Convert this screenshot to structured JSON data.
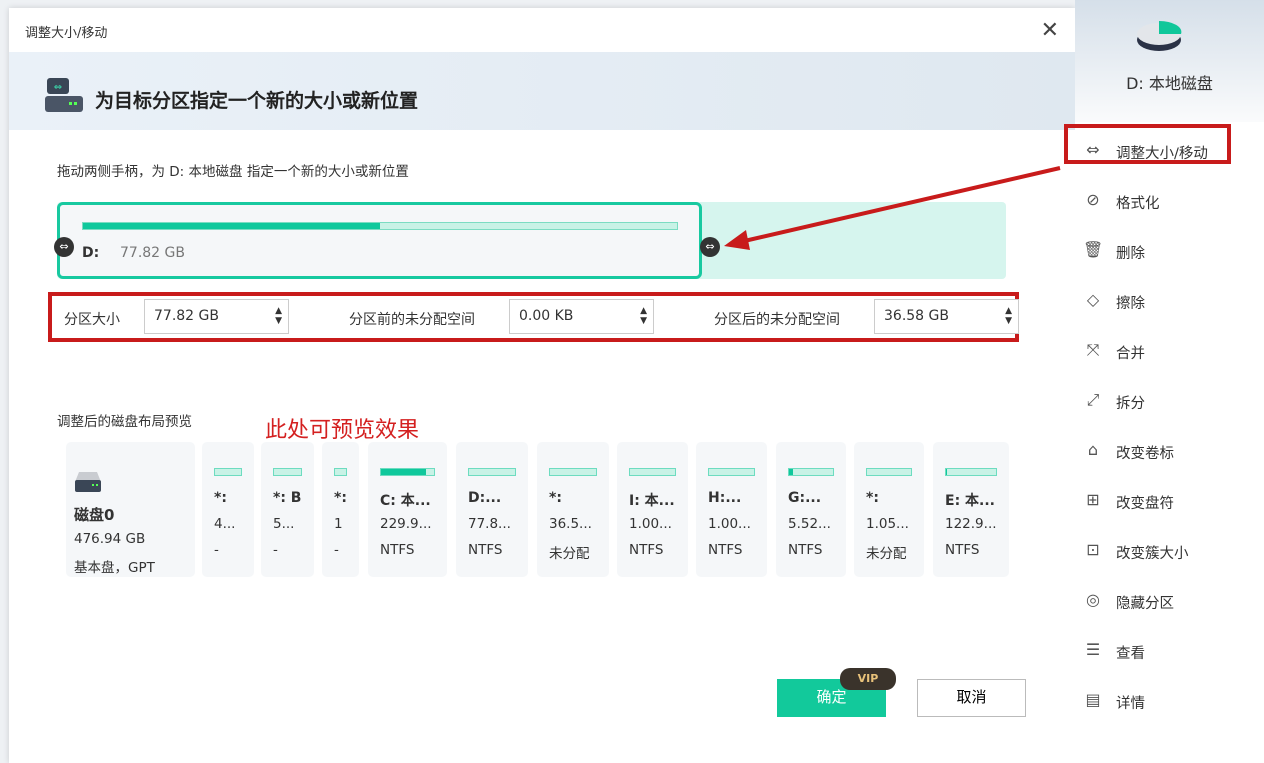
{
  "dialog": {
    "title": "调整大小/移动",
    "header": "为目标分区指定一个新的大小或新位置",
    "instruction": "拖动两侧手柄，为 D: 本地磁盘 指定一个新的大小或新位置"
  },
  "partition": {
    "name": "D:",
    "size": "77.82  GB",
    "used_fraction": 0.5
  },
  "fields": {
    "size_label": "分区大小",
    "size_value": "77.82  GB",
    "before_label": "分区前的未分配空间",
    "before_value": "0.00 KB",
    "after_label": "分区后的未分配空间",
    "after_value": "36.58  GB"
  },
  "preview": {
    "label": "调整后的磁盘布局预览",
    "annotation": "此处可预览效果",
    "disk": {
      "name": "磁盘0",
      "size": "476.94  GB",
      "type": "基本盘，GPT"
    },
    "cards": [
      {
        "name": "*:",
        "size": "4...",
        "fs": "-",
        "fill": 0
      },
      {
        "name": "*: B",
        "size": "5...",
        "fs": "-",
        "fill": 0
      },
      {
        "name": "*:",
        "size": "1",
        "fs": "-",
        "fill": 0
      },
      {
        "name": "C: 本...",
        "size": "229.9...",
        "fs": "NTFS",
        "fill": 0.85
      },
      {
        "name": "D:...",
        "size": "77.8...",
        "fs": "NTFS",
        "fill": 0
      },
      {
        "name": "*:",
        "size": "36.5...",
        "fs": "未分配",
        "fill": 0
      },
      {
        "name": "I: 本...",
        "size": "1.00...",
        "fs": "NTFS",
        "fill": 0
      },
      {
        "name": "H:...",
        "size": "1.00...",
        "fs": "NTFS",
        "fill": 0
      },
      {
        "name": "G:...",
        "size": "5.52...",
        "fs": "NTFS",
        "fill": 0.1
      },
      {
        "name": "*:",
        "size": "1.05...",
        "fs": "未分配",
        "fill": 0
      },
      {
        "name": "E: 本...",
        "size": "122.9...",
        "fs": "NTFS",
        "fill": 0.02
      }
    ]
  },
  "buttons": {
    "ok": "确定",
    "vip": "VIP",
    "cancel": "取消"
  },
  "sidebar": {
    "title": "D: 本地磁盘",
    "items": [
      {
        "label": "调整大小/移动",
        "icon": "resize-icon"
      },
      {
        "label": "格式化",
        "icon": "format-icon"
      },
      {
        "label": "删除",
        "icon": "delete-icon"
      },
      {
        "label": "擦除",
        "icon": "eraser-icon"
      },
      {
        "label": "合并",
        "icon": "merge-icon"
      },
      {
        "label": "拆分",
        "icon": "split-icon"
      },
      {
        "label": "改变卷标",
        "icon": "tag-icon"
      },
      {
        "label": "改变盘符",
        "icon": "drive-letter-icon"
      },
      {
        "label": "改变簇大小",
        "icon": "cluster-icon"
      },
      {
        "label": "隐藏分区",
        "icon": "hide-icon"
      },
      {
        "label": "查看",
        "icon": "view-icon"
      },
      {
        "label": "详情",
        "icon": "details-icon"
      }
    ]
  },
  "colors": {
    "accent": "#12c99b",
    "highlight": "#c81b1b"
  }
}
